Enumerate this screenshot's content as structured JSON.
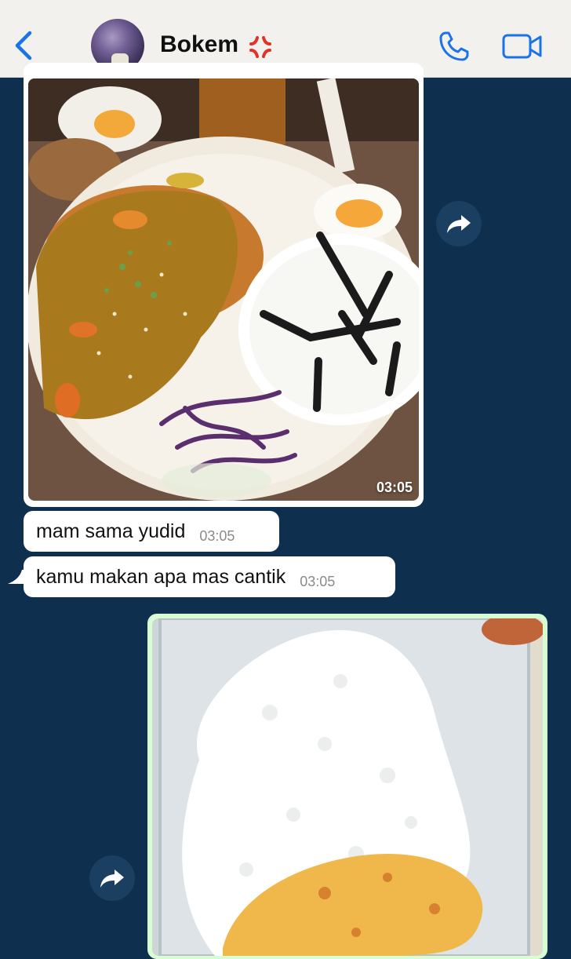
{
  "header": {
    "contact_name": "Bokem",
    "back_icon": "chevron-left-icon",
    "status_emoji_icon": "anger-symbol-icon",
    "call_icon": "phone-icon",
    "video_icon": "video-camera-icon",
    "accent_color": "#1a73e8"
  },
  "chat": {
    "background_color": "#0e2f4d",
    "messages": [
      {
        "type": "image",
        "direction": "incoming",
        "content": "katsu curry plate with rice",
        "time": "03:05"
      },
      {
        "type": "text",
        "direction": "incoming",
        "text": "mam sama yudid",
        "time": "03:05"
      },
      {
        "type": "text",
        "direction": "incoming",
        "text": "kamu makan apa mas cantik",
        "time": "03:05"
      },
      {
        "type": "image",
        "direction": "outgoing",
        "content": "rice with omelette in container"
      }
    ],
    "forward_icon": "forward-arrow-icon"
  }
}
